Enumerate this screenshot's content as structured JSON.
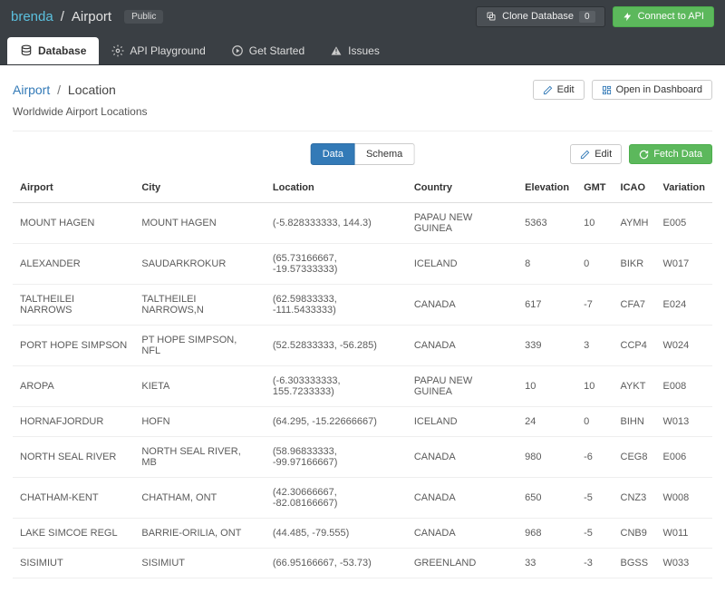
{
  "header": {
    "owner": "brenda",
    "dbname": "Airport",
    "visibility": "Public",
    "clone_label": "Clone Database",
    "clone_count": "0",
    "connect_label": "Connect to API"
  },
  "tabs": [
    {
      "label": "Database"
    },
    {
      "label": "API Playground"
    },
    {
      "label": "Get Started"
    },
    {
      "label": "Issues"
    }
  ],
  "breadcrumb": {
    "root": "Airport",
    "current": "Location",
    "edit": "Edit",
    "open_dash": "Open in Dashboard"
  },
  "description": "Worldwide Airport Locations",
  "segmented": {
    "data": "Data",
    "schema": "Schema"
  },
  "tbl_actions": {
    "edit": "Edit",
    "fetch": "Fetch Data"
  },
  "columns": [
    "Airport",
    "City",
    "Location",
    "Country",
    "Elevation",
    "GMT",
    "ICAO",
    "Variation"
  ],
  "rows": [
    [
      "MOUNT HAGEN",
      "MOUNT HAGEN",
      "(-5.828333333, 144.3)",
      "PAPAU NEW GUINEA",
      "5363",
      "10",
      "AYMH",
      "E005"
    ],
    [
      "ALEXANDER",
      "SAUDARKROKUR",
      "(65.73166667, -19.57333333)",
      "ICELAND",
      "8",
      "0",
      "BIKR",
      "W017"
    ],
    [
      "TALTHEILEI NARROWS",
      "TALTHEILEI NARROWS,N",
      "(62.59833333, -111.5433333)",
      "CANADA",
      "617",
      "-7",
      "CFA7",
      "E024"
    ],
    [
      "PORT HOPE SIMPSON",
      "PT HOPE SIMPSON, NFL",
      "(52.52833333, -56.285)",
      "CANADA",
      "339",
      "3",
      "CCP4",
      "W024"
    ],
    [
      "AROPA",
      "KIETA",
      "(-6.303333333, 155.7233333)",
      "PAPAU NEW GUINEA",
      "10",
      "10",
      "AYKT",
      "E008"
    ],
    [
      "HORNAFJORDUR",
      "HOFN",
      "(64.295, -15.22666667)",
      "ICELAND",
      "24",
      "0",
      "BIHN",
      "W013"
    ],
    [
      "NORTH SEAL RIVER",
      "NORTH SEAL RIVER, MB",
      "(58.96833333, -99.97166667)",
      "CANADA",
      "980",
      "-6",
      "CEG8",
      "E006"
    ],
    [
      "CHATHAM-KENT",
      "CHATHAM, ONT",
      "(42.30666667, -82.08166667)",
      "CANADA",
      "650",
      "-5",
      "CNZ3",
      "W008"
    ],
    [
      "LAKE SIMCOE REGL",
      "BARRIE-ORILIA, ONT",
      "(44.485, -79.555)",
      "CANADA",
      "968",
      "-5",
      "CNB9",
      "W011"
    ],
    [
      "SISIMIUT",
      "SISIMIUT",
      "(66.95166667, -53.73)",
      "GREENLAND",
      "33",
      "-3",
      "BGSS",
      "W033"
    ]
  ]
}
